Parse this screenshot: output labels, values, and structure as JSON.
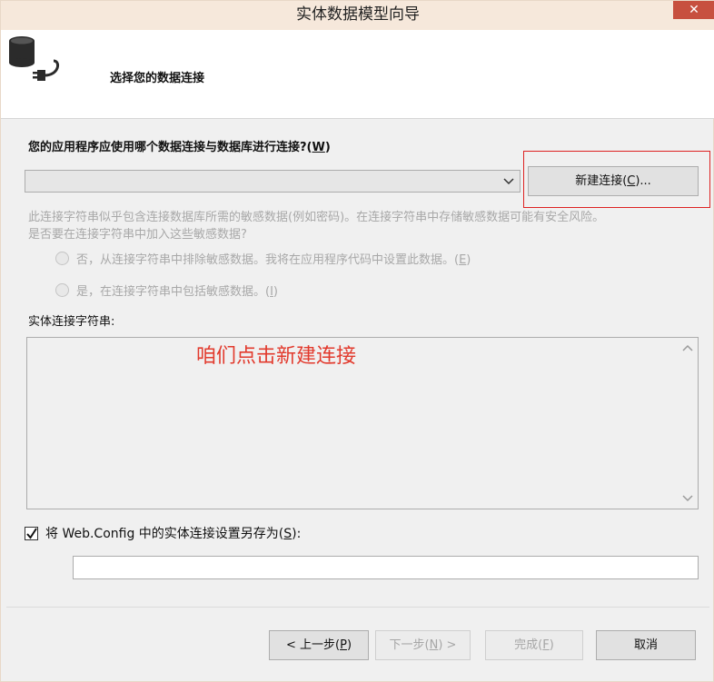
{
  "window": {
    "title": "实体数据模型向导",
    "close_label": "✕"
  },
  "header": {
    "title": "选择您的数据连接",
    "icon": "database-plug-icon"
  },
  "connection": {
    "question_text": "您的应用程序应使用哪个数据连接与数据库进行连接?(",
    "question_key": "W",
    "question_tail": ")",
    "selected_value": "",
    "new_conn_text": "新建连接(",
    "new_conn_key": "C",
    "new_conn_tail": ")..."
  },
  "warning": {
    "line1": "此连接字符串似乎包含连接数据库所需的敏感数据(例如密码)。在连接字符串中存储敏感数据可能有安全风险。",
    "line2": "是否要在连接字符串中加入这些敏感数据?"
  },
  "options": {
    "exclude_text": "否，从连接字符串中排除敏感数据。我将在应用程序代码中设置此数据。(",
    "exclude_key": "E",
    "exclude_tail": ")",
    "include_text": "是，在连接字符串中包括敏感数据。(",
    "include_key": "I",
    "include_tail": ")"
  },
  "entity_string": {
    "label": "实体连接字符串:",
    "value": ""
  },
  "annotation": {
    "text": "咱们点击新建连接",
    "color": "#e23a2d"
  },
  "save": {
    "checked": true,
    "label_text": "将 Web.Config 中的实体连接设置另存为(",
    "label_key": "S",
    "label_tail": "):",
    "value": ""
  },
  "footer": {
    "prev_text": "< 上一步(",
    "prev_key": "P",
    "prev_tail": ")",
    "next_text": "下一步(",
    "next_key": "N",
    "next_tail": ") >",
    "finish_text": "完成(",
    "finish_key": "F",
    "finish_tail": ")",
    "cancel_label": "取消"
  },
  "colors": {
    "titlebar": "#f6e8db",
    "close_button": "#c7503f",
    "highlight_border": "#dd2222"
  }
}
